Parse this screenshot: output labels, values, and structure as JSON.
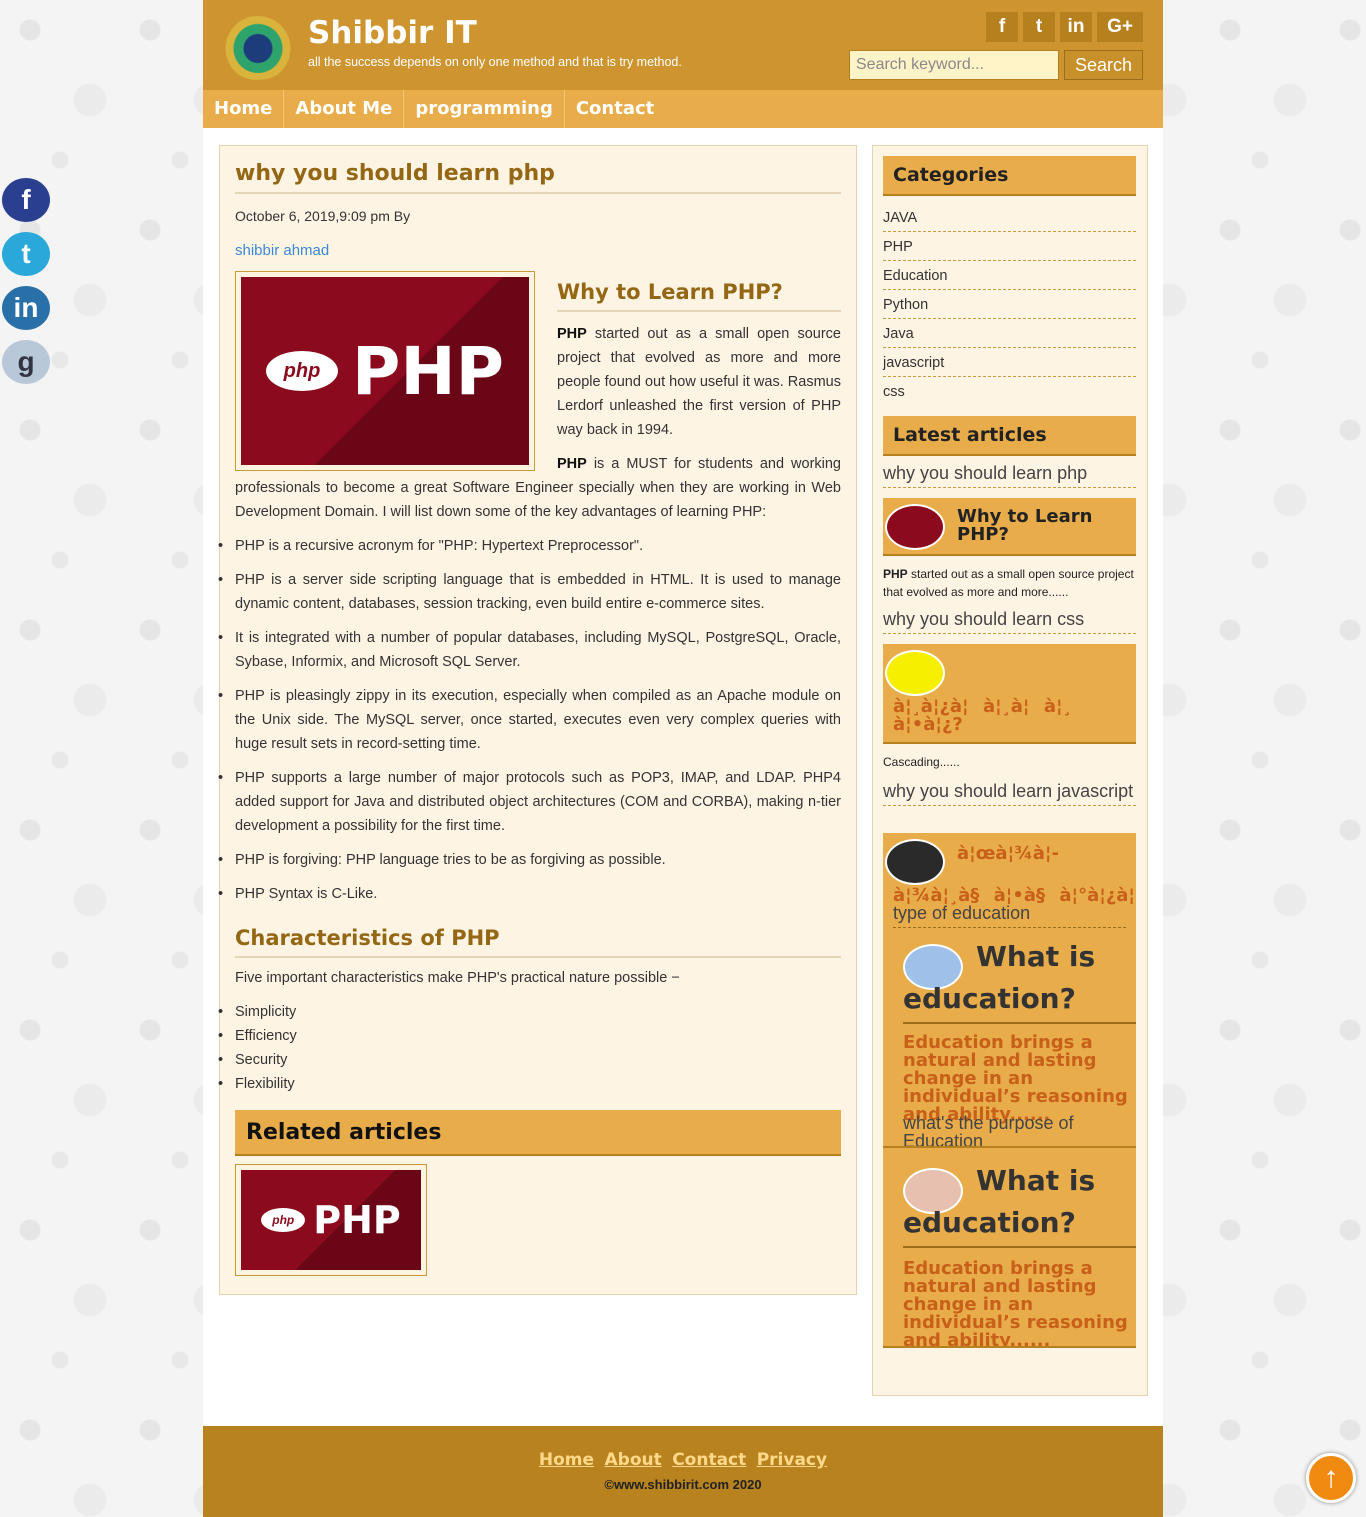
{
  "social_float": [
    "facebook-icon",
    "twitter-icon",
    "linkedin-icon",
    "google-icon"
  ],
  "header": {
    "title": "Shibbir IT",
    "tagline": "all the success depends on only one method and that is try method.",
    "social": [
      "f",
      "t",
      "in",
      "G+"
    ],
    "search_placeholder": "Search keyword...",
    "search_label": "Search"
  },
  "nav": [
    "Home",
    "About Me",
    "programming",
    "Contact"
  ],
  "post": {
    "title": "why you should learn php",
    "meta": "October 6, 2019,9:09 pm By",
    "author": "shibbir ahmad",
    "image_text": "PHP",
    "image_badge": "php",
    "h2_intro": "Why to Learn PHP?",
    "p1_bold": "PHP",
    "p1": " started out as a small open source project that evolved as more and more people found out how useful it was. Rasmus Lerdorf unleashed the first version of PHP way back in 1994.",
    "p2_bold": "PHP",
    "p2": " is a MUST for students and working professionals to become a great Software Engineer specially when they are working in Web Development Domain. I will list down some of the key advantages of learning PHP:",
    "advantages": [
      "PHP is a recursive acronym for \"PHP: Hypertext Preprocessor\".",
      "PHP is a server side scripting language that is embedded in HTML. It is used to manage dynamic content, databases, session tracking, even build entire e-commerce sites.",
      "It is integrated with a number of popular databases, including MySQL, PostgreSQL, Oracle, Sybase, Informix, and Microsoft SQL Server.",
      "PHP is pleasingly zippy in its execution, especially when compiled as an Apache module on the Unix side. The MySQL server, once started, executes even very complex queries with huge result sets in record-setting time.",
      "PHP supports a large number of major protocols such as POP3, IMAP, and LDAP. PHP4 added support for Java and distributed object architectures (COM and CORBA), making n-tier development a possibility for the first time.",
      "PHP is forgiving: PHP language tries to be as forgiving as possible.",
      "PHP Syntax is C-Like."
    ],
    "h2_char": "Characteristics of PHP",
    "char_intro": "Five important characteristics make PHP's practical nature possible −",
    "characteristics": [
      "Simplicity",
      "Efficiency",
      "Security",
      "Flexibility"
    ],
    "related_title": "Related articles"
  },
  "sidebar": {
    "categories_title": "Categories",
    "categories": [
      "JAVA",
      "PHP",
      "Education",
      "Python",
      "Java",
      "javascript",
      "css"
    ],
    "latest_title": "Latest articles",
    "latest": [
      {
        "link": "why you should learn php",
        "card_title": "Why to Learn PHP?",
        "excerpt_bold": "PHP",
        "excerpt": " started out as a small open source project that evolved as more and more......"
      },
      {
        "link": "why you should learn css",
        "card_title_line1": "à¦¸à¦¿à¦à¦¸à¦à¦¸",
        "card_title_line2": "à¦•à¦¿?",
        "excerpt": "Cascading......"
      },
      {
        "link": "why you should learn javascript",
        "card_title_line1": "à¦œà¦¾à¦-",
        "card_title_line2": "à¦¾à¦¸à§à¦•à§à¦°à¦¿à¦ªà"
      },
      {
        "link": "type of education",
        "card_title": "What is education?",
        "body": "Education brings a natural and lasting change in an individual’s reasoning and ability......"
      },
      {
        "link": "what's the purpose of Education",
        "card_title": "What is education?",
        "body": "Education brings a natural and lasting change in an individual’s reasoning and ability......"
      }
    ]
  },
  "footer": {
    "links": [
      "Home",
      "About",
      "Contact",
      "Privacy"
    ],
    "copyright": "©www.shibbirit.com 2020"
  },
  "colors": {
    "header": "#cd9430",
    "nav": "#e8ad4a",
    "heading": "#946715",
    "panel": "#fef4e4",
    "footer": "#b8821f",
    "garbled_text": "#c8601a"
  }
}
